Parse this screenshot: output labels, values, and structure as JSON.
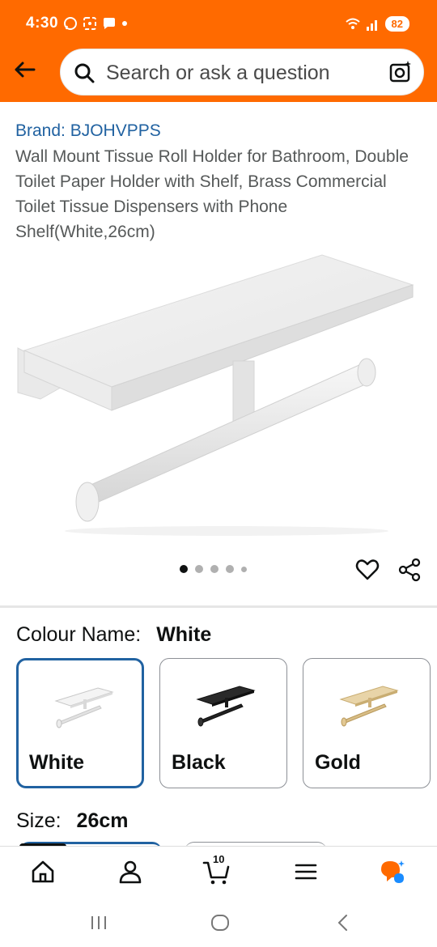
{
  "status_bar": {
    "time": "4:30",
    "battery": "82"
  },
  "header": {
    "back_icon": "arrow-left-icon",
    "search_placeholder": "Search or ask a question",
    "search_icon": "search-icon",
    "camera_icon": "camera-scan-icon",
    "colors": {
      "header_bg": "#ff6a00"
    }
  },
  "product": {
    "brand": "Brand: BJOHVPPS",
    "title": "Wall Mount Tissue Roll Holder for Bathroom, Double Toilet Paper Holder with Shelf, Brass Commercial Toilet Tissue Dispensers with Phone Shelf(White,26cm)",
    "image_count": 5,
    "active_image": 1
  },
  "actions": {
    "wishlist_icon": "heart-icon",
    "share_icon": "share-icon"
  },
  "variants": {
    "colour_label": "Colour Name:",
    "colour_value": "White",
    "options": [
      {
        "name": "White",
        "selected": true
      },
      {
        "name": "Black",
        "selected": false
      },
      {
        "name": "Gold",
        "selected": false
      }
    ],
    "size_label": "Size:",
    "size_value": "26cm"
  },
  "bottom_nav": {
    "items": [
      "home-icon",
      "account-icon",
      "cart-icon",
      "menu-icon",
      "rufus-ai-icon"
    ],
    "cart_count": "10",
    "colors": {
      "accent": "#ff6a00",
      "ai_blue": "#1a8cff"
    }
  },
  "system_nav": [
    "recent-apps-icon",
    "home-circle-icon",
    "back-chevron-icon"
  ]
}
